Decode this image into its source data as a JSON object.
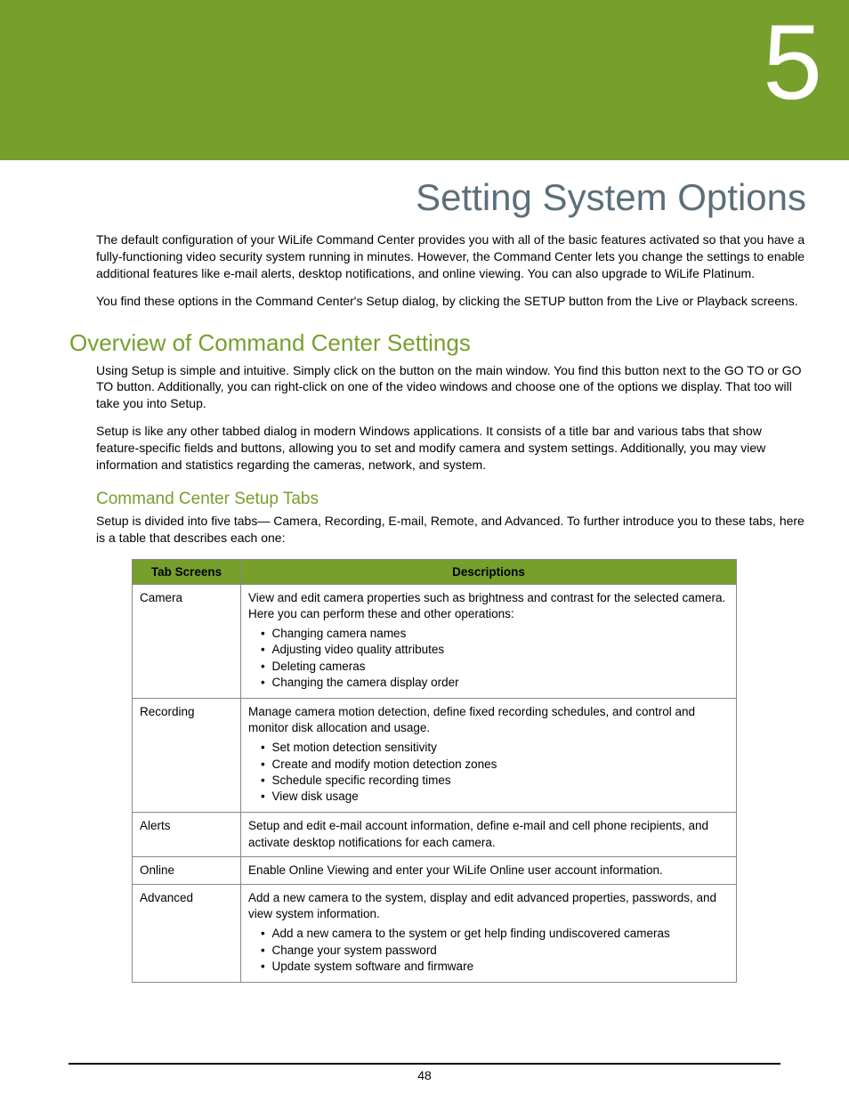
{
  "chapter": {
    "number": "5",
    "title": "Setting System Options"
  },
  "intro": {
    "p1": "The default configuration of your WiLife Command Center provides you with all of the basic features activated so that you have a fully-functioning video security system running in minutes. However, the Command Center lets you change the settings to enable additional features like e-mail alerts, desktop notifications, and online viewing.  You can also upgrade to WiLife Platinum.",
    "p2": "You find these options in the Command Center's Setup dialog, by clicking the SETUP button from the Live or Playback screens."
  },
  "overview": {
    "heading": "Overview of Command Center Settings",
    "p1": "Using Setup is simple and intuitive.  Simply click on the             button on the main window. You find this button next to the GO TO          or GO TO                         button.  Additionally, you can right-click on one of the video windows and choose one of the options we display. That too will take you into Setup.",
    "p2": "Setup is like any other tabbed dialog in modern Windows applications.  It consists of a title bar and various tabs that show feature-specific fields and buttons, allowing you to set and modify camera and system settings.  Additionally, you may view information and statistics regarding the cameras, network, and system."
  },
  "tabs_section": {
    "heading": "Command Center Setup Tabs",
    "intro": "Setup is divided into five tabs— Camera, Recording, E-mail, Remote, and Advanced. To further introduce you to these tabs, here is a table that describes each one:"
  },
  "table": {
    "header": {
      "col1": "Tab Screens",
      "col2": "Descriptions"
    },
    "rows": [
      {
        "name": "Camera",
        "desc": "View and edit camera properties such as brightness and contrast for the selected camera. Here you can perform these and other operations:",
        "bullets": [
          "Changing camera names",
          "Adjusting video quality attributes",
          "Deleting cameras",
          "Changing the camera display order"
        ]
      },
      {
        "name": "Recording",
        "desc": "Manage camera motion detection, define fixed recording schedules, and control and monitor disk allocation and usage.",
        "bullets": [
          "Set motion detection sensitivity",
          "Create and modify motion detection zones",
          "Schedule specific recording times",
          "View disk usage"
        ]
      },
      {
        "name": "Alerts",
        "desc": "Setup and edit e-mail account information, define e-mail and cell phone recipients, and activate desktop notifications for each camera.",
        "bullets": []
      },
      {
        "name": "Online",
        "desc": "Enable Online Viewing and enter your WiLife Online user account information.",
        "bullets": []
      },
      {
        "name": "Advanced",
        "desc": "Add a new camera to the system, display and edit advanced properties, passwords, and view system information.",
        "bullets": [
          "Add a new camera to the system or get help finding undiscovered cameras",
          "Change your system password",
          "Update system software and firmware"
        ]
      }
    ]
  },
  "footer": {
    "page_number": "48"
  }
}
